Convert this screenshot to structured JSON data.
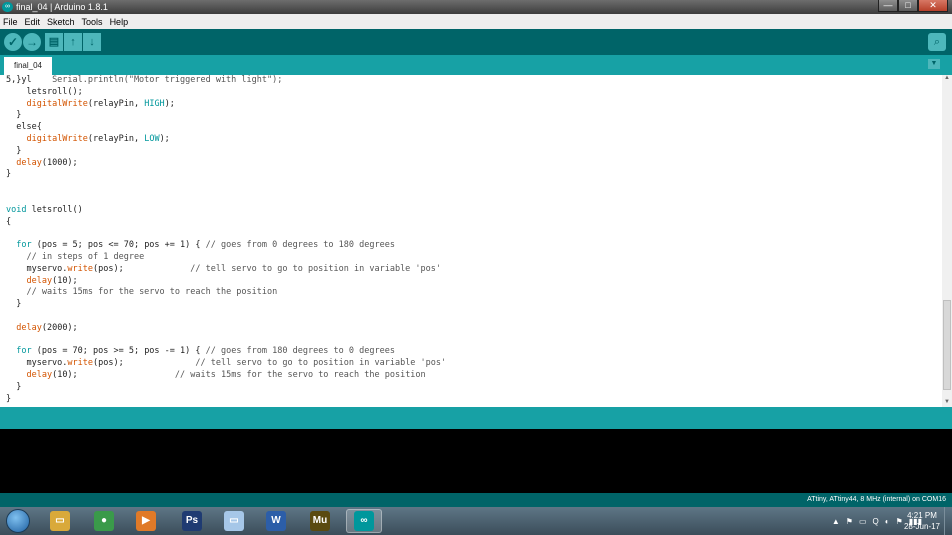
{
  "window": {
    "title": "final_04 | Arduino 1.8.1",
    "controls": [
      "—",
      "□",
      "✕"
    ]
  },
  "menu": [
    "File",
    "Edit",
    "Sketch",
    "Tools",
    "Help"
  ],
  "toolbar": {
    "verify": "✓",
    "upload": "→",
    "new": "▤",
    "open": "↑",
    "save": "↓",
    "serial_monitor": "⌕"
  },
  "tab": {
    "label": "final_04",
    "menu_glyph": "▼"
  },
  "code": [
    [
      {
        "t": "5,}yl    "
      },
      {
        "t": "Serial.println(\"Motor triggered with light\");",
        "c": "cm"
      }
    ],
    [
      {
        "t": "    letsroll();"
      }
    ],
    [
      {
        "t": "    "
      },
      {
        "t": "digitalWrite",
        "c": "kw"
      },
      {
        "t": "(relayPin, "
      },
      {
        "t": "HIGH",
        "c": "ty"
      },
      {
        "t": ");"
      }
    ],
    [
      {
        "t": "  }"
      }
    ],
    [
      {
        "t": "  else{"
      }
    ],
    [
      {
        "t": "    "
      },
      {
        "t": "digitalWrite",
        "c": "kw"
      },
      {
        "t": "(relayPin, "
      },
      {
        "t": "LOW",
        "c": "ty"
      },
      {
        "t": ");"
      }
    ],
    [
      {
        "t": "  }"
      }
    ],
    [
      {
        "t": "  "
      },
      {
        "t": "delay",
        "c": "kw"
      },
      {
        "t": "(1000);"
      }
    ],
    [
      {
        "t": "}"
      }
    ],
    [
      {
        "t": ""
      }
    ],
    [
      {
        "t": ""
      }
    ],
    [
      {
        "t": "void",
        "c": "ty"
      },
      {
        "t": " letsroll()"
      }
    ],
    [
      {
        "t": "{"
      }
    ],
    [
      {
        "t": ""
      }
    ],
    [
      {
        "t": "  "
      },
      {
        "t": "for",
        "c": "ty"
      },
      {
        "t": " (pos = 5; pos <= 70; pos += 1) { "
      },
      {
        "t": "// goes from 0 degrees to 180 degrees",
        "c": "cm"
      }
    ],
    [
      {
        "t": "    "
      },
      {
        "t": "// in steps of 1 degree",
        "c": "cm"
      }
    ],
    [
      {
        "t": "    myservo."
      },
      {
        "t": "write",
        "c": "kw"
      },
      {
        "t": "(pos);             "
      },
      {
        "t": "// tell servo to go to position in variable 'pos'",
        "c": "cm"
      }
    ],
    [
      {
        "t": "    "
      },
      {
        "t": "delay",
        "c": "kw"
      },
      {
        "t": "(10);"
      }
    ],
    [
      {
        "t": "    "
      },
      {
        "t": "// waits 15ms for the servo to reach the position",
        "c": "cm"
      }
    ],
    [
      {
        "t": "  }"
      }
    ],
    [
      {
        "t": ""
      }
    ],
    [
      {
        "t": "  "
      },
      {
        "t": "delay",
        "c": "kw"
      },
      {
        "t": "(2000);"
      }
    ],
    [
      {
        "t": ""
      }
    ],
    [
      {
        "t": "  "
      },
      {
        "t": "for",
        "c": "ty"
      },
      {
        "t": " (pos = 70; pos >= 5; pos -= 1) { "
      },
      {
        "t": "// goes from 180 degrees to 0 degrees",
        "c": "cm"
      }
    ],
    [
      {
        "t": "    myservo."
      },
      {
        "t": "write",
        "c": "kw"
      },
      {
        "t": "(pos);              "
      },
      {
        "t": "// tell servo to go to position in variable 'pos'",
        "c": "cm"
      }
    ],
    [
      {
        "t": "    "
      },
      {
        "t": "delay",
        "c": "kw"
      },
      {
        "t": "(10);                   "
      },
      {
        "t": "// waits 15ms for the servo to reach the position",
        "c": "cm"
      }
    ],
    [
      {
        "t": "  }"
      }
    ],
    [
      {
        "t": "}"
      }
    ]
  ],
  "board_status": "ATtiny, ATtiny44, 8 MHz (internal) on COM16",
  "taskbar": {
    "apps": [
      {
        "name": "explorer",
        "glyph": "▭",
        "color": "#d9a93a"
      },
      {
        "name": "chrome",
        "glyph": "●",
        "color": "#3a9a4a"
      },
      {
        "name": "media-player",
        "glyph": "▶",
        "color": "#e07a28"
      },
      {
        "name": "photoshop",
        "glyph": "Ps",
        "color": "#1f3b72"
      },
      {
        "name": "folder",
        "glyph": "▭",
        "color": "#a6c7e8"
      },
      {
        "name": "word",
        "glyph": "W",
        "color": "#2c5ea8"
      },
      {
        "name": "muse",
        "glyph": "Mu",
        "color": "#5a4a10"
      },
      {
        "name": "arduino",
        "glyph": "∞",
        "color": "#00979c"
      }
    ],
    "tray": [
      "▲",
      "⚑",
      "▭",
      "Q",
      "◐",
      "⚑",
      "▮▮▮"
    ],
    "time": "4:21 PM",
    "date": "28-Jun-17"
  }
}
